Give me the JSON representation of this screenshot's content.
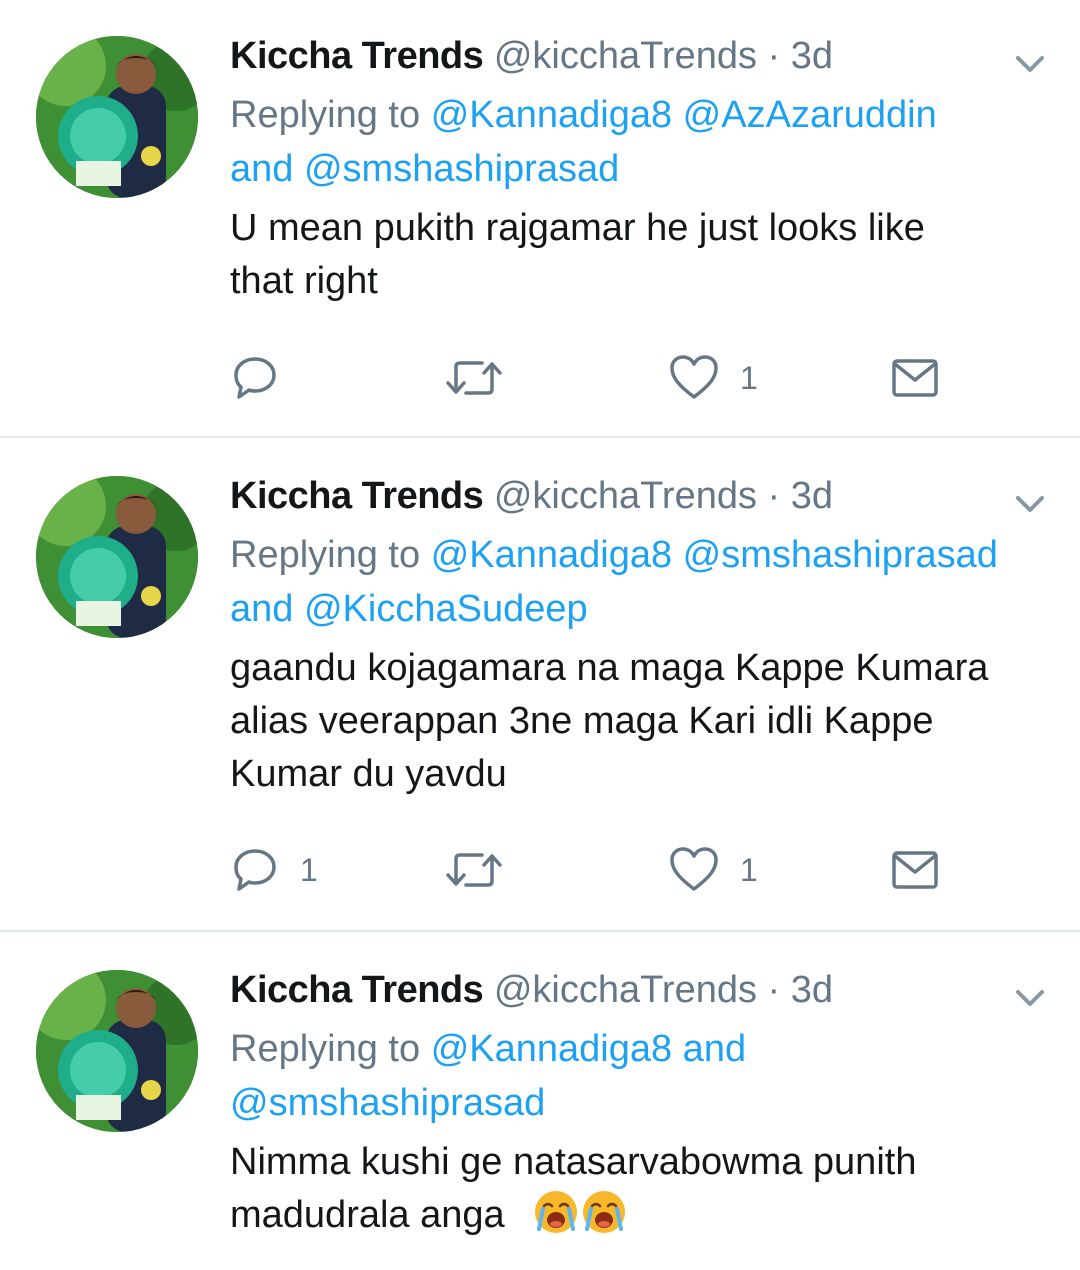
{
  "tweets": [
    {
      "display_name": "Kiccha Trends",
      "handle": "@kicchaTrends",
      "time": "· 3d",
      "replying_prefix": "Replying to",
      "mentions_part1": "@Kannadiga8 @AzAzaruddin",
      "mentions_part2_and": "and",
      "mentions_part2": "@smshashiprasad",
      "body": "U mean pukith rajgamar he just looks like that right",
      "reply_count": "",
      "retweet_count": "",
      "like_count": "1"
    },
    {
      "display_name": "Kiccha Trends",
      "handle": "@kicchaTrends",
      "time": "· 3d",
      "replying_prefix": "Replying to",
      "mentions_part1": "@Kannadiga8 @smshashiprasad",
      "mentions_part2_and": "and",
      "mentions_part2": "@KicchaSudeep",
      "body": "gaandu kojagamara na maga Kappe Kumara alias veerappan 3ne maga Kari idli Kappe Kumar du yavdu",
      "reply_count": "1",
      "retweet_count": "",
      "like_count": "1"
    },
    {
      "display_name": "Kiccha Trends",
      "handle": "@kicchaTrends",
      "time": "· 3d",
      "replying_prefix": "Replying to",
      "mentions_part1": "@Kannadiga8 and",
      "mentions_part2_and": "",
      "mentions_part2": "@smshashiprasad",
      "body": "Nimma kushi ge natasarvabowma punith madudrala anga",
      "emojis": [
        "crying-face-emoji",
        "crying-face-emoji"
      ]
    }
  ],
  "colors": {
    "link": "#1da1f2",
    "secondary_text": "#657786",
    "primary_text": "#14171a",
    "divider": "#e1e8ed"
  },
  "icons": [
    "reply-icon",
    "retweet-icon",
    "like-icon",
    "direct-message-icon",
    "chevron-down-icon",
    "avatar"
  ]
}
